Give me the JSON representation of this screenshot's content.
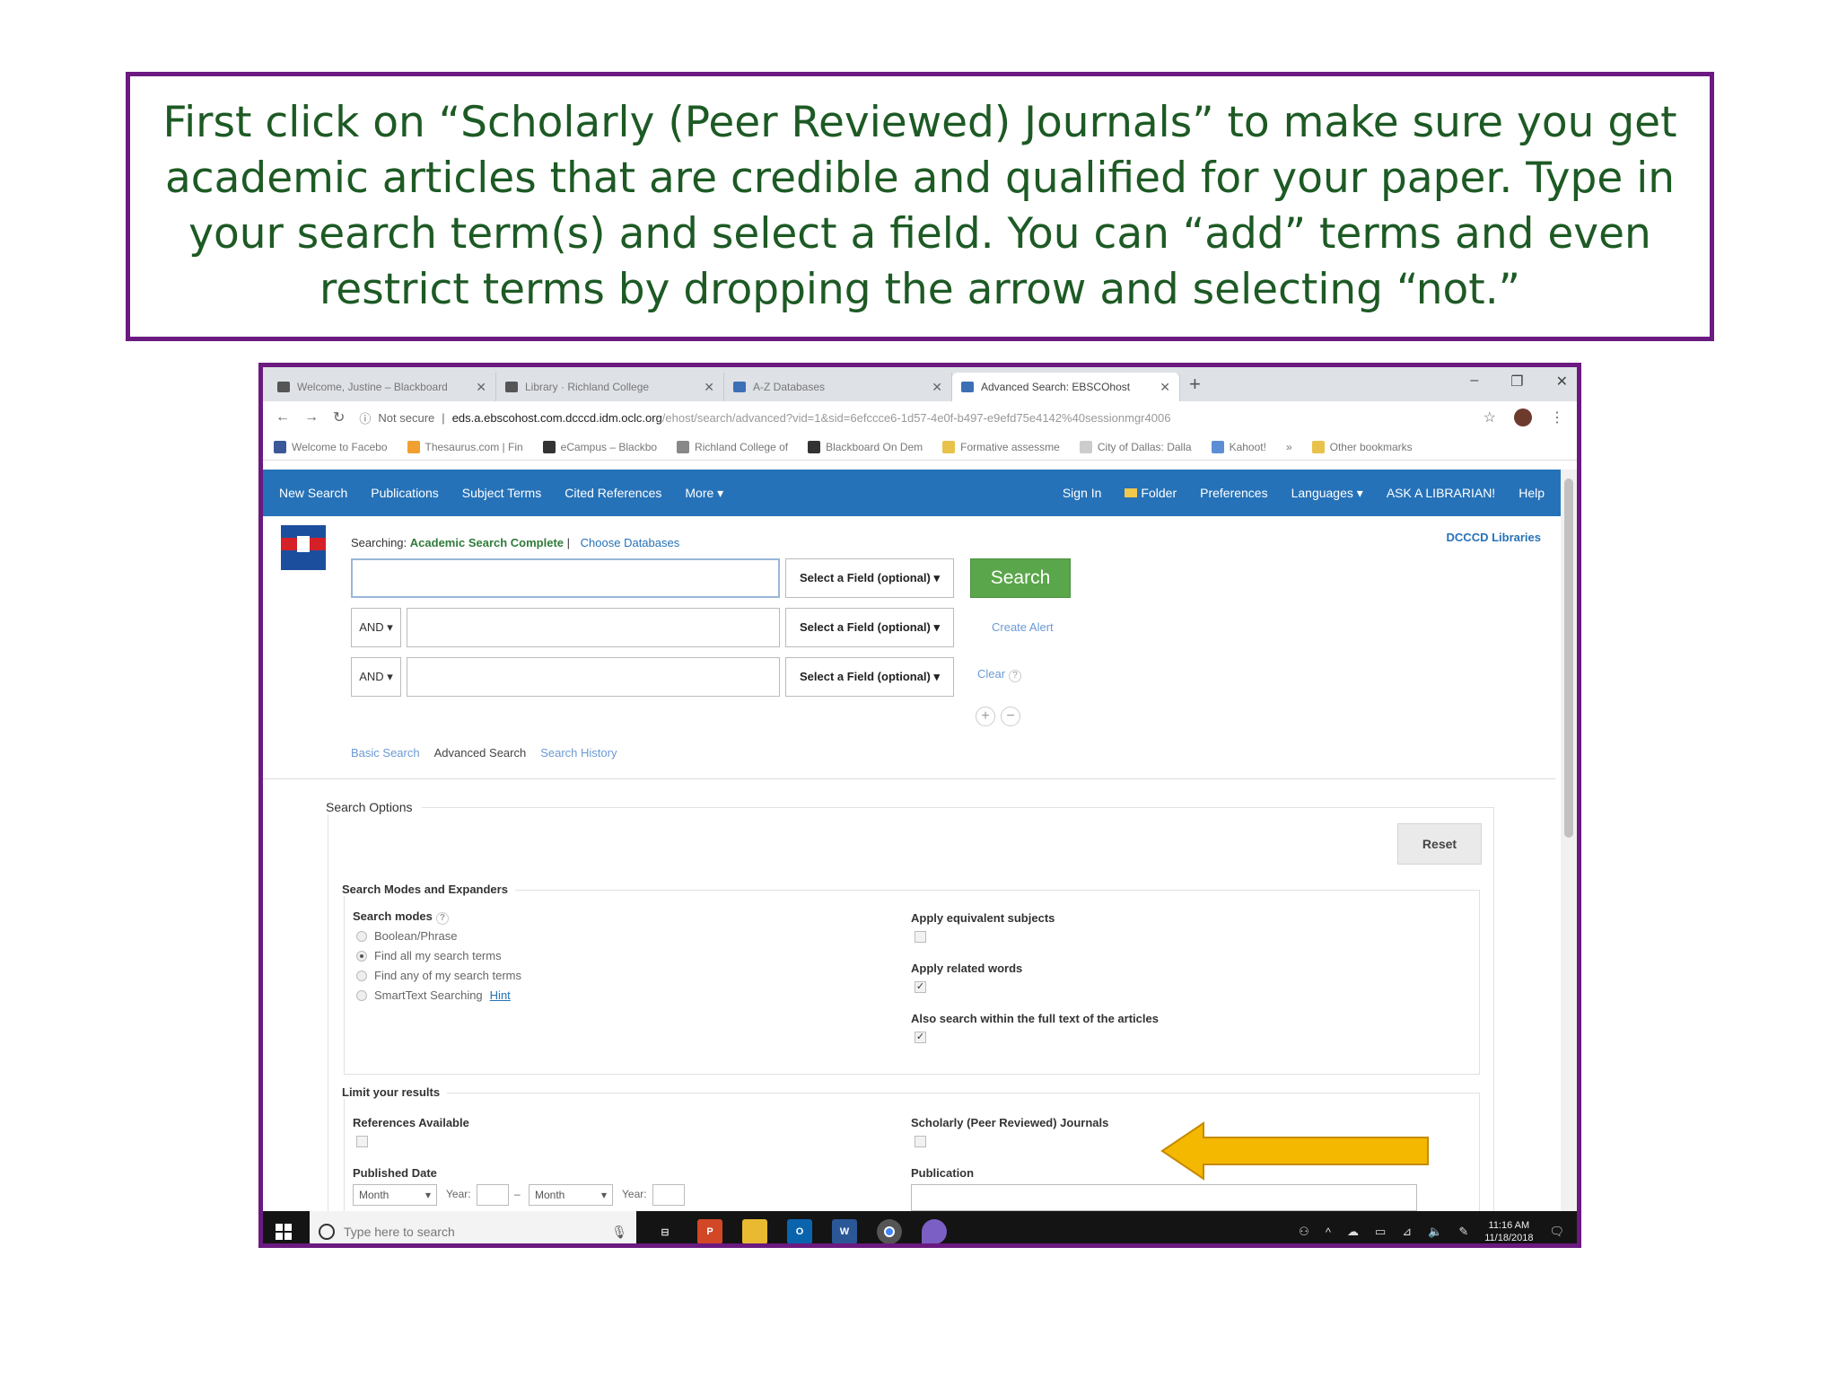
{
  "callout": {
    "text": "First click on “Scholarly (Peer Reviewed) Journals” to make sure you get academic articles that are credible and qualified for your paper. Type in your search term(s) and select a field. You can “add” terms and even restrict terms by  dropping the arrow and selecting “not.”"
  },
  "browser": {
    "tabs": [
      {
        "label": "Welcome, Justine – Blackboard"
      },
      {
        "label": "Library · Richland College"
      },
      {
        "label": "A-Z Databases"
      },
      {
        "label": "Advanced Search: EBSCOhost"
      }
    ],
    "not_secure": "Not secure",
    "url_host": "eds.a.ebscohost.com.dcccd.idm.oclc.org",
    "url_path": "/ehost/search/advanced?vid=1&sid=6efccce6-1d57-4e0f-b497-e9efd75e4142%40sessionmgr4006",
    "bookmarks": [
      {
        "label": "Welcome to Facebo",
        "icon": "facebook-icon"
      },
      {
        "label": "Thesaurus.com | Fin",
        "icon": "thesaurus-icon"
      },
      {
        "label": "eCampus – Blackbo",
        "icon": "blackboard-icon"
      },
      {
        "label": "Richland College of",
        "icon": "globe-icon"
      },
      {
        "label": "Blackboard On Dem",
        "icon": "blackboard-icon"
      },
      {
        "label": "Formative assessme",
        "icon": "bookmark-icon"
      },
      {
        "label": "City of Dallas: Dalla",
        "icon": "page-icon"
      },
      {
        "label": "Kahoot!",
        "icon": "kahoot-icon"
      }
    ],
    "other_bookmarks": "Other bookmarks"
  },
  "toolbar": {
    "left": [
      "New Search",
      "Publications",
      "Subject Terms",
      "Cited References",
      "More ▾"
    ],
    "sign_in": "Sign In",
    "folder": "Folder",
    "right": [
      "Preferences",
      "Languages ▾",
      "ASK A LIBRARIAN!",
      "Help"
    ]
  },
  "search": {
    "searching_label": "Searching:",
    "database": "Academic Search Complete",
    "choose_databases": "Choose Databases",
    "institution": "DCCCD Libraries",
    "field_label": "Select a Field (optional) ▾",
    "bool_label": "AND ▾",
    "search_button": "Search",
    "create_alert": "Create Alert",
    "clear": "Clear",
    "basic_search": "Basic Search",
    "advanced_search": "Advanced Search",
    "search_history": "Search History"
  },
  "options": {
    "title": "Search Options",
    "reset": "Reset",
    "modes_section": "Search Modes and Expanders",
    "search_modes_label": "Search modes",
    "modes": [
      {
        "label": "Boolean/Phrase",
        "selected": false
      },
      {
        "label": "Find all my search terms",
        "selected": true
      },
      {
        "label": "Find any of my search terms",
        "selected": false
      },
      {
        "label": "SmartText Searching",
        "selected": false
      }
    ],
    "hint": "Hint",
    "apply_equivalent": "Apply equivalent subjects",
    "apply_related": "Apply related words",
    "also_search_full_text": "Also search within the full text of the articles",
    "limit_section": "Limit your results",
    "references_available": "References Available",
    "scholarly": "Scholarly (Peer Reviewed) Journals",
    "published_date": "Published Date",
    "publication": "Publication",
    "month": "Month",
    "year": "Year:"
  },
  "taskbar": {
    "search_placeholder": "Type here to search",
    "time": "11:16 AM",
    "date": "11/18/2018"
  },
  "colors": {
    "frame": "#6b1a80",
    "callout_text": "#1d5a24",
    "ebsco_blue": "#2672b8",
    "search_green": "#5aa64a",
    "arrow": "#f5b800"
  }
}
